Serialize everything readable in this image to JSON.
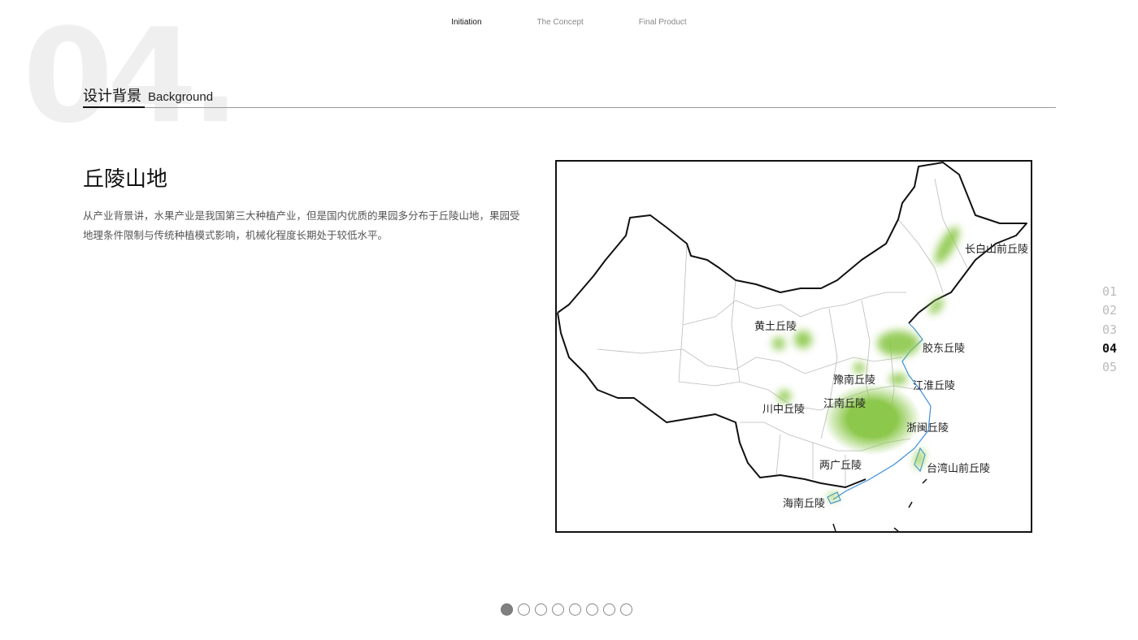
{
  "section_number": "04.",
  "nav": [
    "Initiation",
    "The Concept",
    "Final Product"
  ],
  "section": {
    "cn": "设计背景",
    "en": "Background"
  },
  "heading": "丘陵山地",
  "description": "从产业背景讲，水果产业是我国第三大种植产业，但是国内优质的果园多分布于丘陵山地，果园受地理条件限制与传统种植模式影响，机械化程度长期处于较低水平。",
  "map_labels": [
    "长白山前丘陵",
    "黄土丘陵",
    "胶东丘陵",
    "豫南丘陵",
    "江淮丘陵",
    "川中丘陵",
    "江南丘陵",
    "浙闽丘陵",
    "两广丘陵",
    "台湾山前丘陵",
    "海南丘陵"
  ],
  "side_nav": [
    "01",
    "02",
    "03",
    "04",
    "05"
  ],
  "side_active": "04",
  "pagination": {
    "total": 8,
    "current": 1
  },
  "colors": {
    "highlight": "#8cc84b",
    "coast": "#3b8de0"
  }
}
